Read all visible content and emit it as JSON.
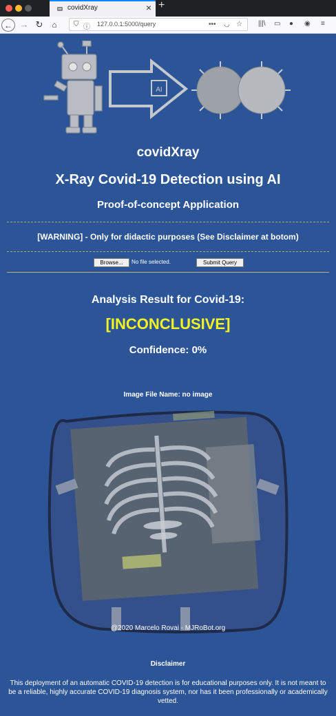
{
  "browser": {
    "tab_title": "covidXray",
    "url": "127.0.0.1:5000/query",
    "new_tab": "+",
    "close_tab": "×"
  },
  "page": {
    "app_name": "covidXray",
    "title": "X-Ray Covid-19 Detection using AI",
    "subtitle": "Proof-of-concept Application",
    "warning": "[WARNING] - Only for didactic purposes (See Disclaimer at botom)",
    "upload": {
      "browse_label": "Browse...",
      "file_status": "No file selected.",
      "submit_label": "Submit Query"
    },
    "result": {
      "label": "Analysis Result for Covid-19:",
      "value": "[INCONCLUSIVE]",
      "confidence": "Confidence: 0%"
    },
    "image_file_name": "Image File Name: no image",
    "hero_chip_label": "AI",
    "copyright": "@2020 Marcelo Rovai - MJRoBot.org",
    "disclaimer": {
      "title": "Disclaimer",
      "text": "This deployment of an automatic COVID-19 detection is for educational purposes only. It is not meant to be a reliable, highly accurate COVID-19 diagnosis system, nor has it been professionally or academically vetted."
    }
  },
  "colors": {
    "page_background": "#2c5597",
    "result_highlight": "#f5f31f"
  },
  "icons": [
    "back-arrow-icon",
    "forward-arrow-icon",
    "reload-icon",
    "home-icon",
    "shield-icon",
    "info-icon",
    "more-icon",
    "pocket-icon",
    "star-icon",
    "library-icon",
    "sidebar-icon",
    "account-icon",
    "extension-icon",
    "menu-icon"
  ]
}
